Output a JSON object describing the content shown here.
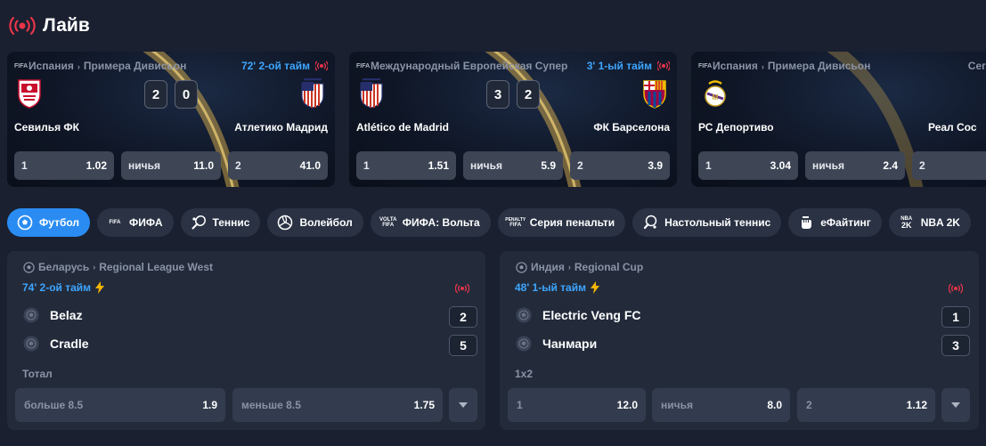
{
  "page": {
    "title": "Лайв",
    "live_icon": "live-broadcast-icon",
    "accent": "#e8344a"
  },
  "featured": [
    {
      "league_prefix": "Испания",
      "league": "Примера Дивисьон",
      "time": "72' 2-ой тайм",
      "home": {
        "name": "Севилья ФК",
        "crest": "sevilla-crest-icon",
        "score": "2"
      },
      "away": {
        "name": "Атлетико Мадрид",
        "crest": "atletico-crest-icon",
        "score": "0"
      },
      "odds": [
        {
          "label": "1",
          "value": "1.02"
        },
        {
          "label": "ничья",
          "value": "11.0"
        },
        {
          "label": "2",
          "value": "41.0"
        }
      ]
    },
    {
      "league_prefix": "Международный Европейская Супер",
      "league": "",
      "time": "3' 1-ый тайм",
      "home": {
        "name": "Atlético de Madrid",
        "crest": "atletico-crest-icon",
        "score": "3"
      },
      "away": {
        "name": "ФК Барселона",
        "crest": "barcelona-crest-icon",
        "score": "2"
      },
      "odds": [
        {
          "label": "1",
          "value": "1.51"
        },
        {
          "label": "ничья",
          "value": "5.9"
        },
        {
          "label": "2",
          "value": "3.9"
        }
      ]
    },
    {
      "league_prefix": "Испания",
      "league": "Примера Дивисьон",
      "time": "Сегодня",
      "home": {
        "name": "РС Депортиво",
        "crest": "real-madrid-crest-icon"
      },
      "away": {
        "name": "Реал Сос"
      },
      "odds": [
        {
          "label": "1",
          "value": "3.04"
        },
        {
          "label": "ничья",
          "value": "2.4"
        },
        {
          "label": "2",
          "value": ""
        }
      ]
    }
  ],
  "tabs": [
    {
      "label": "Футбол",
      "icon": "soccer-ball-icon",
      "active": true
    },
    {
      "label": "ФИФА",
      "icon": "fifa-icon"
    },
    {
      "label": "Теннис",
      "icon": "tennis-racket-icon"
    },
    {
      "label": "Волейбол",
      "icon": "volleyball-icon"
    },
    {
      "label": "ФИФА: Вольта",
      "icon": "volta-fifa-icon"
    },
    {
      "label": "Серия пенальти",
      "icon": "penalty-fifa-icon"
    },
    {
      "label": "Настольный теннис",
      "icon": "table-tennis-icon"
    },
    {
      "label": "еФайтинг",
      "icon": "fist-icon"
    },
    {
      "label": "NBA 2K",
      "icon": "nba2k-icon"
    }
  ],
  "matches": [
    {
      "country": "Беларусь",
      "league": "Regional League West",
      "time": "74' 2-ой тайм",
      "home": {
        "name": "Belaz",
        "score": "2"
      },
      "away": {
        "name": "Cradle",
        "score": "5"
      },
      "market": "Тотал",
      "odds": [
        {
          "label": "больше 8.5",
          "value": "1.9"
        },
        {
          "label": "меньше 8.5",
          "value": "1.75"
        }
      ]
    },
    {
      "country": "Индия",
      "league": "Regional Cup",
      "time": "48' 1-ый тайм",
      "home": {
        "name": "Electric Veng FC",
        "score": "1"
      },
      "away": {
        "name": "Чанмари",
        "score": "3"
      },
      "market": "1x2",
      "odds": [
        {
          "label": "1",
          "value": "12.0"
        },
        {
          "label": "ничья",
          "value": "8.0"
        },
        {
          "label": "2",
          "value": "1.12"
        }
      ]
    }
  ],
  "icon_labels": {
    "fifa": "FIFA",
    "volta": "VOLTA",
    "penalty": "PENALTY",
    "nba": "NBA",
    "twok": "2K"
  }
}
